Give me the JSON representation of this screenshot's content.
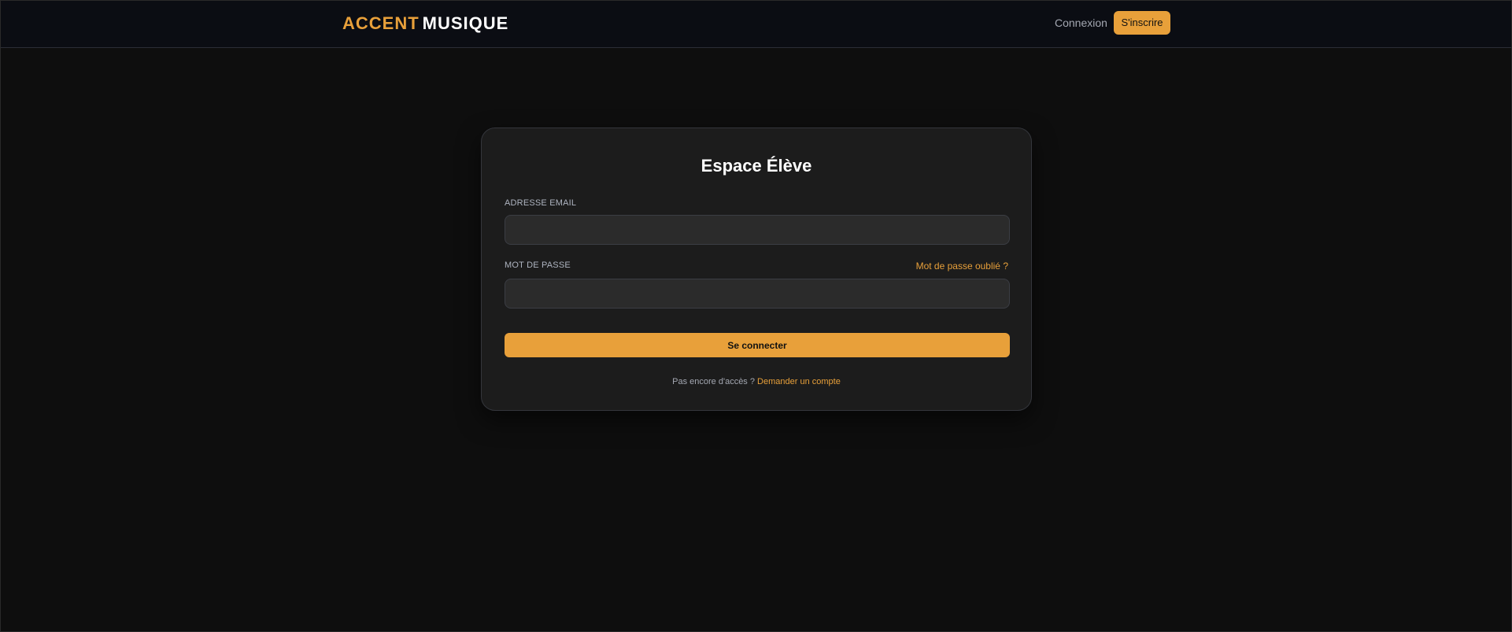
{
  "header": {
    "logo": {
      "accent": "ACCENT",
      "main": "MUSIQUE"
    },
    "nav": {
      "login_label": "Connexion",
      "signup_label": "S'inscrire"
    }
  },
  "login_card": {
    "title": "Espace Élève",
    "email": {
      "label": "ADRESSE EMAIL",
      "value": ""
    },
    "password": {
      "label": "MOT DE PASSE",
      "value": "",
      "forgot_label": "Mot de passe oublié ?"
    },
    "submit_label": "Se connecter",
    "footer": {
      "prompt": "Pas encore d'accès ?",
      "link_label": "Demander un compte"
    }
  },
  "colors": {
    "accent": "#e8a03a",
    "background": "#0e0e0e",
    "topbar": "#0b0d13",
    "card": "#1c1c1c",
    "input": "#2b2b2b"
  }
}
